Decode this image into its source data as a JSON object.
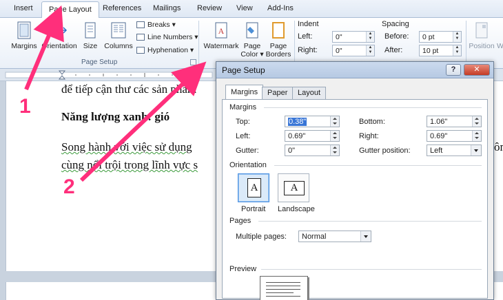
{
  "ribbon_tabs": [
    "Insert",
    "Page Layout",
    "References",
    "Mailings",
    "Review",
    "View",
    "Add-Ins"
  ],
  "ribbon": {
    "margins": "Margins",
    "orientation": "Orientation",
    "size": "Size",
    "columns": "Columns",
    "breaks": "Breaks",
    "line_numbers": "Line Numbers",
    "hyphenation": "Hyphenation",
    "page_setup_group": "Page Setup",
    "watermark": "Watermark",
    "page_color_1": "Page",
    "page_color_2": "Color",
    "page_borders_1": "Page",
    "page_borders_2": "Borders",
    "indent_title": "Indent",
    "indent_left_label": "Left:",
    "indent_left_value": "0\"",
    "indent_right_label": "Right:",
    "indent_right_value": "0\"",
    "spacing_title": "Spacing",
    "spacing_before_label": "Before:",
    "spacing_before_value": "0 pt",
    "spacing_after_label": "After:",
    "spacing_after_value": "10 pt",
    "position": "Position",
    "wrap_1": "W"
  },
  "document": {
    "line1": "để tiếp cận thư các sản phẩm",
    "heading": "Năng lượng xanh: gió",
    "para_line1": "Song hành với việc sử dụng",
    "para_line2": "cùng nổi trội trong lĩnh vực s",
    "right_fragment": "ôn"
  },
  "annotations": {
    "n1": "1",
    "n2": "2"
  },
  "dialog": {
    "title": "Page Setup",
    "help": "?",
    "close": "✕",
    "tabs": [
      "Margins",
      "Paper",
      "Layout"
    ],
    "margins_section": "Margins",
    "top_label": "Top:",
    "top_value": "0.38\"",
    "bottom_label": "Bottom:",
    "bottom_value": "1.06\"",
    "left_label": "Left:",
    "left_value": "0.69\"",
    "right_label": "Right:",
    "right_value": "0.69\"",
    "gutter_label": "Gutter:",
    "gutter_value": "0\"",
    "gutter_pos_label": "Gutter position:",
    "gutter_pos_value": "Left",
    "orientation_section": "Orientation",
    "portrait": "Portrait",
    "landscape": "Landscape",
    "pages_section": "Pages",
    "multiple_pages_label": "Multiple pages:",
    "multiple_pages_value": "Normal",
    "preview_section": "Preview",
    "icon_letter": "A"
  },
  "colors": {
    "annotation": "#ff2f7b",
    "selection": "#3875d6",
    "close_button": "#c43c26"
  }
}
